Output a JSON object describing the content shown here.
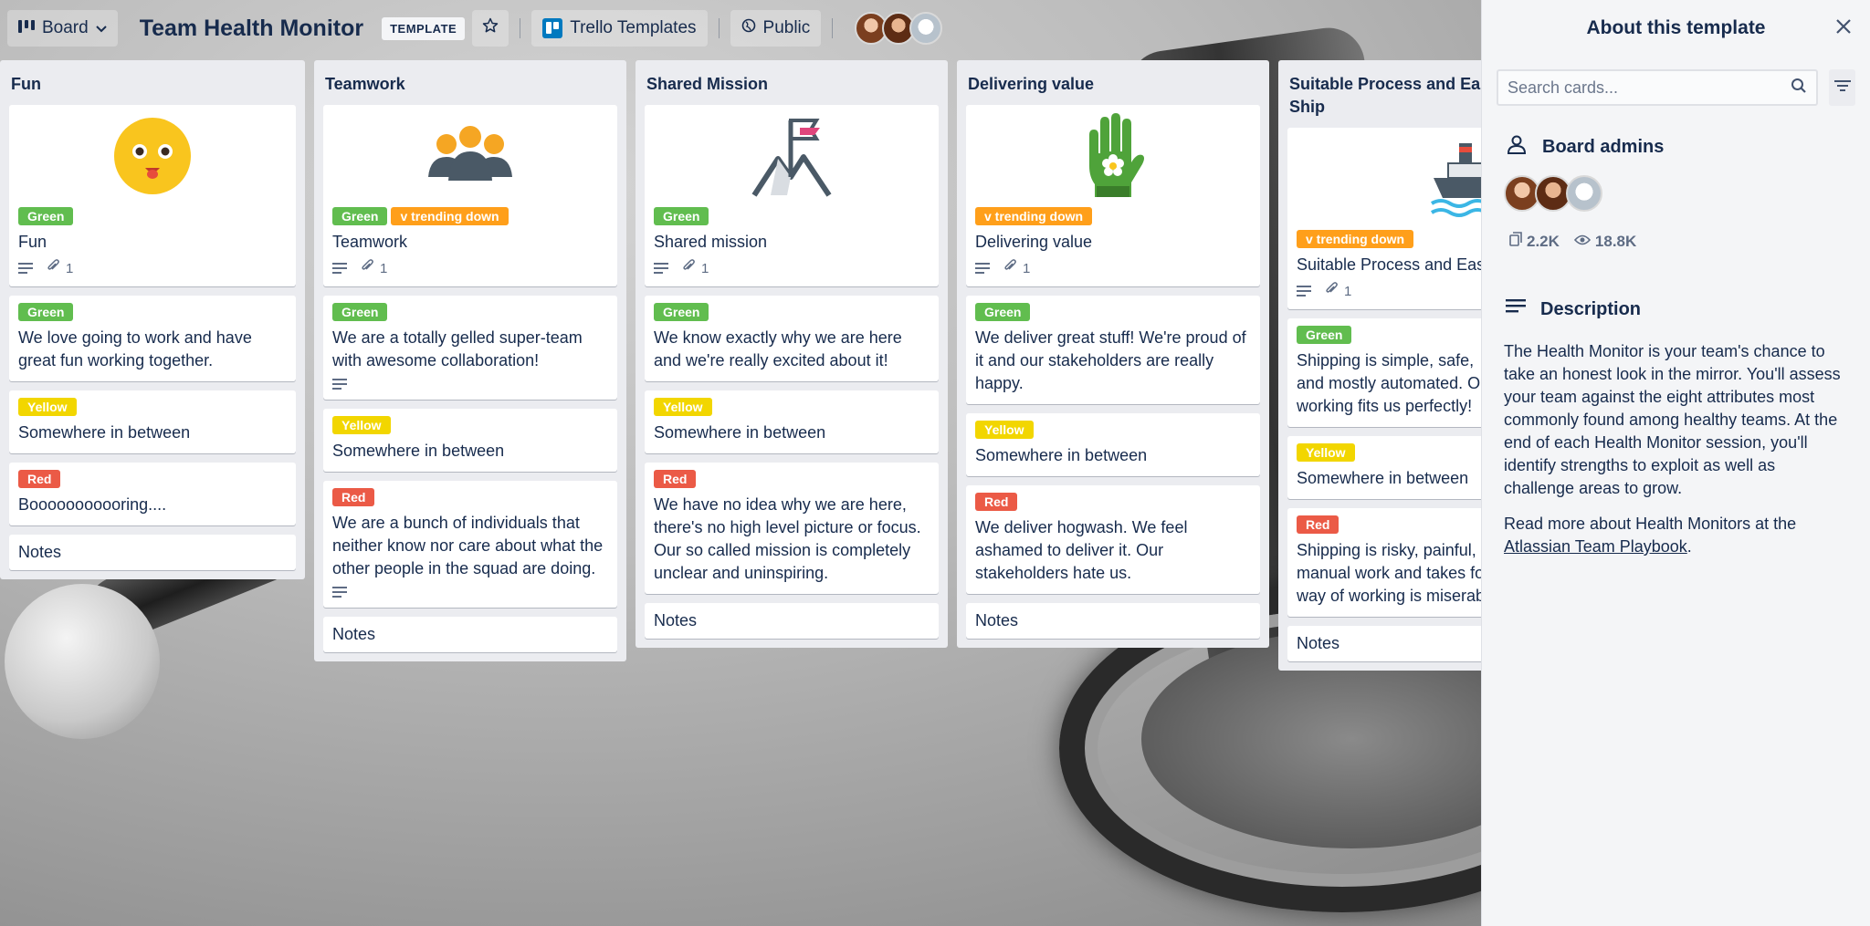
{
  "header": {
    "board_view": "Board",
    "board_title": "Team Health Monitor",
    "template_badge": "TEMPLATE",
    "workspace": "Trello Templates",
    "visibility": "Public"
  },
  "lists": [
    {
      "title": "Fun",
      "cover_card": {
        "labels": [
          "Green"
        ],
        "title": "Fun",
        "attachments": "1"
      },
      "cards": [
        {
          "label": "Green",
          "text": "We love going to work and have great fun working together."
        },
        {
          "label": "Yellow",
          "text": "Somewhere in between"
        },
        {
          "label": "Red",
          "text": "Booooooooooring...."
        }
      ],
      "notes": "Notes"
    },
    {
      "title": "Teamwork",
      "cover_card": {
        "labels": [
          "Green",
          "v trending down"
        ],
        "title": "Teamwork",
        "attachments": "1"
      },
      "cards": [
        {
          "label": "Green",
          "text": "We are a totally gelled super-team with awesome collaboration!"
        },
        {
          "label": "Yellow",
          "text": "Somewhere in between"
        },
        {
          "label": "Red",
          "text": "We are a bunch of individuals that neither know nor care about what the other people in the squad are doing."
        }
      ],
      "notes": "Notes"
    },
    {
      "title": "Shared Mission",
      "cover_card": {
        "labels": [
          "Green"
        ],
        "title": "Shared mission",
        "attachments": "1"
      },
      "cards": [
        {
          "label": "Green",
          "text": "We know exactly why we are here and we're really excited about it!"
        },
        {
          "label": "Yellow",
          "text": "Somewhere in between"
        },
        {
          "label": "Red",
          "text": "We have no idea why we are here, there's no high level picture or focus. Our so called mission is completely unclear and uninspiring."
        }
      ],
      "notes": "Notes"
    },
    {
      "title": "Delivering value",
      "cover_card": {
        "labels": [
          "v trending down"
        ],
        "title": "Delivering value",
        "attachments": "1"
      },
      "cards": [
        {
          "label": "Green",
          "text": "We deliver great stuff! We're proud of it and our stakeholders are really happy."
        },
        {
          "label": "Yellow",
          "text": "Somewhere in between"
        },
        {
          "label": "Red",
          "text": "We deliver hogwash. We feel ashamed to deliver it. Our stakeholders hate us."
        }
      ],
      "notes": "Notes"
    },
    {
      "title": "Suitable Process and Ea",
      "title_line2": "Ship",
      "cover_card": {
        "labels": [
          "v trending down"
        ],
        "title": "Suitable Process and Eas",
        "attachments": "1"
      },
      "cards": [
        {
          "label": "Green",
          "text_lines": [
            "Shipping is simple, safe,",
            "and mostly automated. O",
            "working fits us perfectly!"
          ]
        },
        {
          "label": "Yellow",
          "text": "Somewhere in between"
        },
        {
          "label": "Red",
          "text_lines": [
            "Shipping is risky, painful,",
            "manual work and takes fo",
            "way of working is miserab"
          ]
        }
      ],
      "notes": "Notes"
    }
  ],
  "panel": {
    "title": "About this template",
    "search_placeholder": "Search cards...",
    "admins_heading": "Board admins",
    "copies": "2.2K",
    "views": "18.8K",
    "description_heading": "Description",
    "description": "The Health Monitor is your team's chance to take an honest look in the mirror. You'll assess your team against the eight attributes most commonly found among healthy teams. At the end of each Health Monitor session, you'll identify strengths to exploit as well as challenge areas to grow.",
    "read_more_prefix": "Read more about Health Monitors at the",
    "read_more_link": "Atlassian Team Playbook",
    "read_more_suffix": "."
  },
  "colors": {
    "green": "#61bd4f",
    "yellow": "#f2d600",
    "red": "#eb5a46",
    "orange": "#ff9f1a",
    "trello_blue": "#0079bf"
  },
  "icons": {
    "board_view": "board-icon",
    "star": "star-icon",
    "visibility": "globe-icon",
    "close": "close-icon",
    "search": "search-icon",
    "filter": "filter-icon",
    "admins": "person-icon",
    "description": "description-icon",
    "attachment": "paperclip-icon",
    "copies": "copy-icon",
    "views": "eye-icon"
  }
}
